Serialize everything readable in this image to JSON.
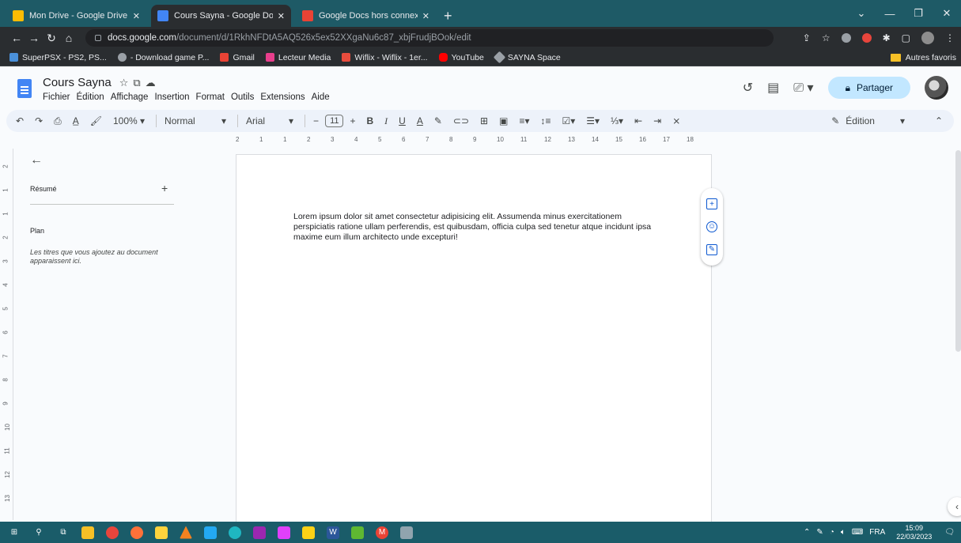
{
  "browser": {
    "tabs": [
      {
        "title": "Mon Drive - Google Drive",
        "color": "#fbbc04"
      },
      {
        "title": "Cours Sayna - Google Docs",
        "color": "#4285f4"
      },
      {
        "title": "Google Docs hors connexion - C",
        "color": "#e94335"
      }
    ],
    "new_tab": "+",
    "url_host": "docs.google.com",
    "url_path": "/document/d/1RkhNFDtA5AQ526x5ex52XXgaNu6c87_xbjFrudjBOok/edit",
    "bookmarks": [
      {
        "label": "SuperPSX - PS2, PS...",
        "color": "#4a90d9"
      },
      {
        "label": "- Download game P...",
        "color": "#9aa0a6"
      },
      {
        "label": "Gmail",
        "color": "#ea4335"
      },
      {
        "label": "Lecteur Media",
        "color": "#e83e8c"
      },
      {
        "label": "Wiflix - Wiflix - 1er...",
        "color": "#e84c3d"
      },
      {
        "label": "YouTube",
        "color": "#ff0000"
      },
      {
        "label": "SAYNA Space",
        "color": "#9aa0a6"
      }
    ],
    "other_bookmarks": "Autres favoris"
  },
  "docs": {
    "title": "Cours Sayna",
    "menu": [
      "Fichier",
      "Édition",
      "Affichage",
      "Insertion",
      "Format",
      "Outils",
      "Extensions",
      "Aide"
    ],
    "share_label": "Partager",
    "toolbar": {
      "zoom": "100%",
      "style": "Normal",
      "font": "Arial",
      "font_size": "11",
      "mode": "Édition"
    },
    "outline": {
      "summary_label": "Résumé",
      "plan_label": "Plan",
      "plan_hint": "Les titres que vous ajoutez au document apparaissent ici."
    },
    "body_text": "Lorem ipsum dolor sit amet consectetur adipisicing elit. Assumenda minus exercitationem perspiciatis ratione ullam perferendis, est quibusdam, officia culpa sed tenetur atque incidunt ipsa maxime eum illum architecto unde excepturi!",
    "ruler_labels": [
      "2",
      "1",
      "1",
      "2",
      "3",
      "4",
      "5",
      "6",
      "7",
      "8",
      "9",
      "10",
      "11",
      "12",
      "13",
      "14",
      "15",
      "16",
      "17",
      "18"
    ],
    "vruler_labels": [
      "2",
      "1",
      "1",
      "2",
      "3",
      "4",
      "5",
      "6",
      "7",
      "8",
      "9",
      "10",
      "11",
      "12",
      "13"
    ]
  },
  "taskbar": {
    "language": "FRA",
    "time": "15:09",
    "date": "22/03/2023"
  }
}
